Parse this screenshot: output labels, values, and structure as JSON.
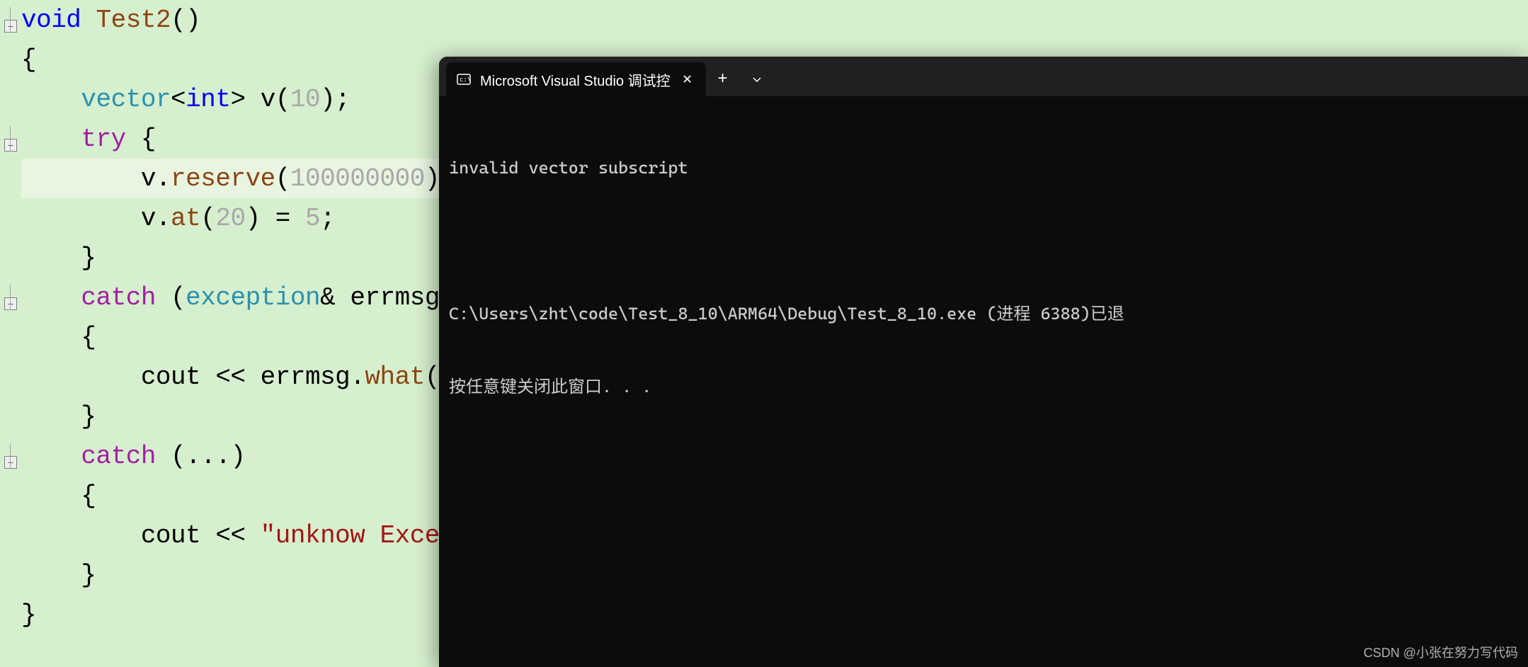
{
  "editor": {
    "code_lines": [
      {
        "tokens": [
          {
            "t": "void",
            "c": "kw-blue"
          },
          {
            "t": " ",
            "c": "kw-default"
          },
          {
            "t": "Test2",
            "c": "kw-method"
          },
          {
            "t": "()",
            "c": "kw-default"
          }
        ],
        "fold": "minus"
      },
      {
        "tokens": [
          {
            "t": "{",
            "c": "kw-default"
          }
        ],
        "fold": ""
      },
      {
        "tokens": [
          {
            "t": "    ",
            "c": "kw-default"
          },
          {
            "t": "vector",
            "c": "kw-type"
          },
          {
            "t": "<",
            "c": "kw-default"
          },
          {
            "t": "int",
            "c": "kw-int"
          },
          {
            "t": "> ",
            "c": "kw-default"
          },
          {
            "t": "v",
            "c": "kw-default"
          },
          {
            "t": "(",
            "c": "kw-default"
          },
          {
            "t": "10",
            "c": "kw-num"
          },
          {
            "t": ");",
            "c": "kw-default"
          }
        ],
        "fold": ""
      },
      {
        "tokens": [
          {
            "t": "    ",
            "c": "kw-default"
          },
          {
            "t": "try",
            "c": "kw-purple"
          },
          {
            "t": " {",
            "c": "kw-default"
          }
        ],
        "fold": "minus"
      },
      {
        "tokens": [
          {
            "t": "        v.",
            "c": "kw-default"
          },
          {
            "t": "reserve",
            "c": "kw-method"
          },
          {
            "t": "(",
            "c": "kw-default"
          },
          {
            "t": "100000000",
            "c": "kw-num"
          },
          {
            "t": ");",
            "c": "kw-default"
          }
        ],
        "fold": "",
        "highlighted": true
      },
      {
        "tokens": [
          {
            "t": "        v.",
            "c": "kw-default"
          },
          {
            "t": "at",
            "c": "kw-method"
          },
          {
            "t": "(",
            "c": "kw-default"
          },
          {
            "t": "20",
            "c": "kw-num"
          },
          {
            "t": ") = ",
            "c": "kw-default"
          },
          {
            "t": "5",
            "c": "kw-num"
          },
          {
            "t": ";",
            "c": "kw-default"
          }
        ],
        "fold": ""
      },
      {
        "tokens": [
          {
            "t": "    }",
            "c": "kw-default"
          }
        ],
        "fold": ""
      },
      {
        "tokens": [
          {
            "t": "    ",
            "c": "kw-default"
          },
          {
            "t": "catch",
            "c": "kw-purple"
          },
          {
            "t": " (",
            "c": "kw-default"
          },
          {
            "t": "exception",
            "c": "kw-type"
          },
          {
            "t": "& errmsg)",
            "c": "kw-default"
          }
        ],
        "fold": "minus"
      },
      {
        "tokens": [
          {
            "t": "    {",
            "c": "kw-default"
          }
        ],
        "fold": ""
      },
      {
        "tokens": [
          {
            "t": "        cout << errmsg.",
            "c": "kw-default"
          },
          {
            "t": "what",
            "c": "kw-method"
          },
          {
            "t": "() <<",
            "c": "kw-default"
          }
        ],
        "fold": ""
      },
      {
        "tokens": [
          {
            "t": "    }",
            "c": "kw-default"
          }
        ],
        "fold": ""
      },
      {
        "tokens": [
          {
            "t": "    ",
            "c": "kw-default"
          },
          {
            "t": "catch",
            "c": "kw-purple"
          },
          {
            "t": " (...)",
            "c": "kw-default"
          }
        ],
        "fold": "minus"
      },
      {
        "tokens": [
          {
            "t": "    {",
            "c": "kw-default"
          }
        ],
        "fold": ""
      },
      {
        "tokens": [
          {
            "t": "        cout << ",
            "c": "kw-default"
          },
          {
            "t": "\"unknow Exceptio",
            "c": "kw-str"
          }
        ],
        "fold": ""
      },
      {
        "tokens": [
          {
            "t": "    }",
            "c": "kw-default"
          }
        ],
        "fold": ""
      },
      {
        "tokens": [
          {
            "t": "}",
            "c": "kw-default"
          }
        ],
        "fold": ""
      }
    ]
  },
  "terminal": {
    "tab_title": "Microsoft Visual Studio 调试控",
    "output_line1": "invalid vector subscript",
    "output_line2": "C:\\Users\\zht\\code\\Test_8_10\\ARM64\\Debug\\Test_8_10.exe (进程 6388)已退",
    "output_line3": "按任意键关闭此窗口. . ."
  },
  "watermark": "CSDN @小张在努力写代码"
}
